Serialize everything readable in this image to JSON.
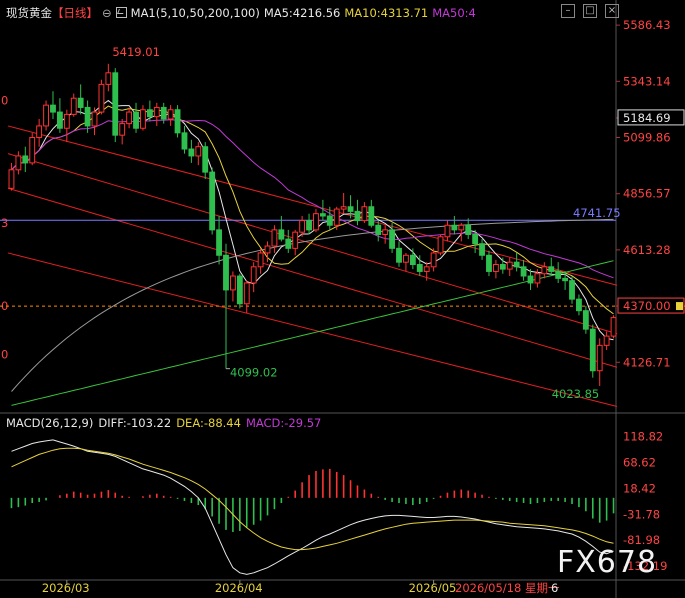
{
  "header": {
    "title": "现货黄金",
    "period": "【日线】",
    "settings_glyph": "⊖",
    "ma_label": "MA1(5,10,50,200,100)",
    "ma5": "MA5:4216.56",
    "ma10": "MA10:4313.71",
    "ma50": "MA50:4"
  },
  "macd_header": {
    "label": "MACD(26,12,9)",
    "diff": "DIFF:-103.22",
    "dea": "DEA:-88.44",
    "macd": "MACD:-29.57"
  },
  "window_controls": [
    "–",
    "□",
    "×"
  ],
  "watermark": "FX678",
  "colors": {
    "background": "#000000",
    "up": "#ff3232",
    "down": "#2fbf4f",
    "ma5": "#e8e8e8",
    "ma10": "#e6d23a",
    "ma50": "#c23ad6",
    "ma200": "#3cc43c",
    "ma100": "#9a9a9a",
    "channel": "#e02020",
    "hline": "#7a7aff",
    "price_line": "#ff8c00"
  },
  "chart_data": {
    "type": "candlestick",
    "price_axis": {
      "ticks": [
        5586.43,
        5343.14,
        5184.69,
        5099.86,
        4856.57,
        4613.28,
        4370.0,
        4126.71
      ],
      "range": [
        3920,
        5600
      ]
    },
    "macd_axis": {
      "ticks": [
        118.82,
        68.62,
        18.42,
        -31.78,
        -81.98,
        -132.19
      ],
      "range": [
        -155,
        135
      ]
    },
    "x_ticks": [
      "2026/03",
      "2026/04",
      "2026/05"
    ],
    "cursor_date": "2026/05/18 星期一",
    "cursor_value": "6",
    "annotations": {
      "high": "5419.01",
      "low_march": "4099.02",
      "low_recent": "4023.85",
      "hline": "4741.75",
      "current": "4370.00",
      "box": "5184.69"
    },
    "ohlc": [
      [
        4880,
        4990,
        4870,
        4960
      ],
      [
        4960,
        5040,
        4940,
        5020
      ],
      [
        5020,
        5060,
        4950,
        4990
      ],
      [
        4990,
        5120,
        4980,
        5100
      ],
      [
        5100,
        5180,
        5060,
        5150
      ],
      [
        5150,
        5260,
        5130,
        5240
      ],
      [
        5240,
        5300,
        5180,
        5210
      ],
      [
        5210,
        5270,
        5120,
        5140
      ],
      [
        5140,
        5220,
        5080,
        5200
      ],
      [
        5200,
        5290,
        5190,
        5270
      ],
      [
        5270,
        5330,
        5200,
        5230
      ],
      [
        5230,
        5260,
        5120,
        5150
      ],
      [
        5150,
        5230,
        5110,
        5210
      ],
      [
        5210,
        5350,
        5200,
        5330
      ],
      [
        5330,
        5419,
        5300,
        5380
      ],
      [
        5380,
        5400,
        5080,
        5110
      ],
      [
        5110,
        5180,
        5070,
        5160
      ],
      [
        5160,
        5230,
        5140,
        5210
      ],
      [
        5210,
        5250,
        5120,
        5140
      ],
      [
        5140,
        5240,
        5130,
        5220
      ],
      [
        5220,
        5260,
        5170,
        5190
      ],
      [
        5190,
        5250,
        5150,
        5230
      ],
      [
        5230,
        5250,
        5160,
        5180
      ],
      [
        5180,
        5240,
        5150,
        5220
      ],
      [
        5220,
        5240,
        5100,
        5120
      ],
      [
        5120,
        5150,
        5030,
        5050
      ],
      [
        5050,
        5090,
        4990,
        5020
      ],
      [
        5020,
        5080,
        4980,
        5060
      ],
      [
        5060,
        5080,
        4920,
        4950
      ],
      [
        4950,
        4970,
        4680,
        4700
      ],
      [
        4700,
        4760,
        4550,
        4590
      ],
      [
        4590,
        4640,
        4099,
        4440
      ],
      [
        4440,
        4520,
        4390,
        4500
      ],
      [
        4500,
        4510,
        4360,
        4380
      ],
      [
        4380,
        4480,
        4340,
        4470
      ],
      [
        4470,
        4560,
        4430,
        4540
      ],
      [
        4540,
        4620,
        4510,
        4600
      ],
      [
        4600,
        4650,
        4560,
        4630
      ],
      [
        4630,
        4720,
        4600,
        4700
      ],
      [
        4700,
        4760,
        4650,
        4660
      ],
      [
        4660,
        4700,
        4600,
        4620
      ],
      [
        4620,
        4700,
        4590,
        4690
      ],
      [
        4690,
        4760,
        4670,
        4740
      ],
      [
        4740,
        4770,
        4680,
        4700
      ],
      [
        4700,
        4790,
        4690,
        4770
      ],
      [
        4770,
        4830,
        4740,
        4760
      ],
      [
        4760,
        4800,
        4700,
        4720
      ],
      [
        4720,
        4800,
        4700,
        4790
      ],
      [
        4790,
        4860,
        4770,
        4800
      ],
      [
        4800,
        4850,
        4750,
        4780
      ],
      [
        4780,
        4830,
        4720,
        4740
      ],
      [
        4740,
        4820,
        4730,
        4800
      ],
      [
        4800,
        4830,
        4710,
        4720
      ],
      [
        4720,
        4740,
        4650,
        4680
      ],
      [
        4680,
        4720,
        4640,
        4700
      ],
      [
        4700,
        4730,
        4600,
        4620
      ],
      [
        4620,
        4650,
        4540,
        4560
      ],
      [
        4560,
        4600,
        4520,
        4590
      ],
      [
        4590,
        4620,
        4530,
        4550
      ],
      [
        4550,
        4590,
        4500,
        4520
      ],
      [
        4520,
        4560,
        4480,
        4540
      ],
      [
        4540,
        4620,
        4520,
        4600
      ],
      [
        4600,
        4680,
        4590,
        4670
      ],
      [
        4670,
        4740,
        4650,
        4720
      ],
      [
        4720,
        4760,
        4680,
        4700
      ],
      [
        4700,
        4730,
        4650,
        4720
      ],
      [
        4720,
        4750,
        4660,
        4680
      ],
      [
        4680,
        4700,
        4600,
        4640
      ],
      [
        4640,
        4660,
        4570,
        4590
      ],
      [
        4590,
        4610,
        4500,
        4520
      ],
      [
        4520,
        4570,
        4490,
        4550
      ],
      [
        4550,
        4580,
        4510,
        4530
      ],
      [
        4530,
        4580,
        4500,
        4560
      ],
      [
        4560,
        4600,
        4520,
        4540
      ],
      [
        4540,
        4570,
        4480,
        4500
      ],
      [
        4500,
        4530,
        4440,
        4470
      ],
      [
        4470,
        4530,
        4450,
        4510
      ],
      [
        4510,
        4560,
        4490,
        4540
      ],
      [
        4540,
        4580,
        4500,
        4520
      ],
      [
        4520,
        4560,
        4470,
        4490
      ],
      [
        4490,
        4520,
        4440,
        4480
      ],
      [
        4480,
        4500,
        4380,
        4400
      ],
      [
        4400,
        4420,
        4330,
        4350
      ],
      [
        4350,
        4370,
        4250,
        4270
      ],
      [
        4270,
        4290,
        4060,
        4090
      ],
      [
        4090,
        4230,
        4023.85,
        4200
      ],
      [
        4200,
        4260,
        4180,
        4240
      ],
      [
        4240,
        4330,
        4230,
        4320
      ]
    ],
    "macd_hist": [
      -20,
      -18,
      -15,
      -10,
      -8,
      -5,
      0,
      5,
      8,
      12,
      10,
      6,
      8,
      12,
      15,
      10,
      4,
      2,
      0,
      3,
      6,
      8,
      4,
      2,
      -2,
      -6,
      -10,
      -14,
      -22,
      -36,
      -50,
      -62,
      -66,
      -64,
      -58,
      -52,
      -44,
      -34,
      -22,
      -10,
      2,
      14,
      30,
      44,
      52,
      55,
      56,
      50,
      44,
      34,
      24,
      16,
      8,
      2,
      -4,
      -8,
      -10,
      -12,
      -14,
      -12,
      -8,
      -2,
      4,
      10,
      14,
      16,
      14,
      10,
      6,
      2,
      -2,
      -4,
      -6,
      -8,
      -10,
      -12,
      -10,
      -8,
      -6,
      -6,
      -8,
      -12,
      -18,
      -26,
      -40,
      -48,
      -44,
      -30
    ],
    "diff": [
      90,
      95,
      100,
      105,
      108,
      110,
      112,
      108,
      104,
      100,
      95,
      90,
      88,
      86,
      84,
      80,
      74,
      68,
      62,
      56,
      52,
      48,
      44,
      38,
      30,
      22,
      12,
      0,
      -20,
      -50,
      -80,
      -110,
      -135,
      -145,
      -148,
      -145,
      -140,
      -135,
      -128,
      -120,
      -112,
      -105,
      -98,
      -90,
      -82,
      -75,
      -70,
      -64,
      -58,
      -52,
      -47,
      -43,
      -40,
      -37,
      -35,
      -34,
      -34,
      -35,
      -36,
      -37,
      -38,
      -38,
      -37,
      -36,
      -36,
      -37,
      -39,
      -41,
      -44,
      -47,
      -50,
      -52,
      -54,
      -56,
      -57,
      -58,
      -59,
      -60,
      -62,
      -64,
      -67,
      -70,
      -76,
      -84,
      -94,
      -105,
      -108,
      -103
    ],
    "dea": [
      60,
      66,
      72,
      78,
      84,
      88,
      92,
      95,
      96,
      96,
      95,
      92,
      90,
      88,
      86,
      83,
      79,
      75,
      70,
      65,
      61,
      57,
      53,
      49,
      44,
      39,
      33,
      26,
      17,
      6,
      -5,
      -18,
      -32,
      -46,
      -58,
      -68,
      -77,
      -84,
      -90,
      -95,
      -98,
      -100,
      -100,
      -99,
      -97,
      -94,
      -91,
      -88,
      -84,
      -80,
      -76,
      -72,
      -68,
      -64,
      -60,
      -57,
      -54,
      -51,
      -49,
      -48,
      -47,
      -46,
      -45,
      -44,
      -43,
      -43,
      -43,
      -43,
      -44,
      -45,
      -46,
      -47,
      -49,
      -50,
      -51,
      -52,
      -53,
      -54,
      -56,
      -58,
      -60,
      -62,
      -65,
      -69,
      -74,
      -80,
      -85,
      -88
    ]
  }
}
